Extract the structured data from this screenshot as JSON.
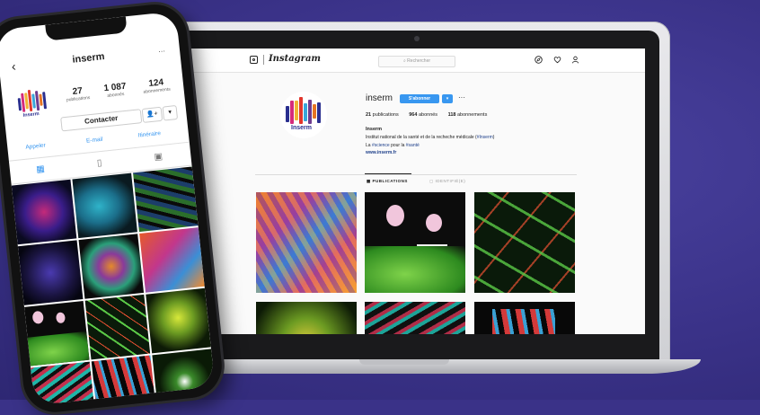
{
  "colors": {
    "background": "#3a3288",
    "instagram_blue": "#3897f0",
    "link_blue": "#1d3f8a"
  },
  "desktop": {
    "brand": "Instagram",
    "search_placeholder": "Rechercher",
    "nav_icons": [
      "compass-icon",
      "heart-icon",
      "user-icon"
    ],
    "profile": {
      "username": "inserm",
      "follow_label": "S'abonner",
      "follow_dropdown": "▾",
      "more": "···",
      "publications_count": "21",
      "publications_label": "publications",
      "followers_count": "964",
      "followers_label": "abonnés",
      "following_count": "118",
      "following_label": "abonnements",
      "display_name": "Inserm",
      "bio_line1_a": "Institut national de la santé et de la recheche médicale (",
      "bio_line1_tag": "#Inserm",
      "bio_line1_b": ")",
      "bio_line2_a": "La ",
      "bio_line2_tag1": "#science",
      "bio_line2_b": " pour la ",
      "bio_line2_tag2": "#santé",
      "website": "www.inserm.fr",
      "logo_text": "Inserm"
    },
    "tabs": {
      "publications": "PUBLICATIONS",
      "identified": "IDENTIFIÉ(E)"
    }
  },
  "mobile": {
    "username": "inserm",
    "back": "‹",
    "more": "···",
    "publications_count": "27",
    "publications_label": "publications",
    "followers_count": "1 087",
    "followers_label": "abonnés",
    "following_count": "124",
    "following_label": "abonnements",
    "contact_label": "Contacter",
    "add_person": "👤+",
    "chevron": "▾",
    "actions": [
      "Appeler",
      "E-mail",
      "Itinéraire"
    ],
    "logo_text": "Inserm"
  }
}
